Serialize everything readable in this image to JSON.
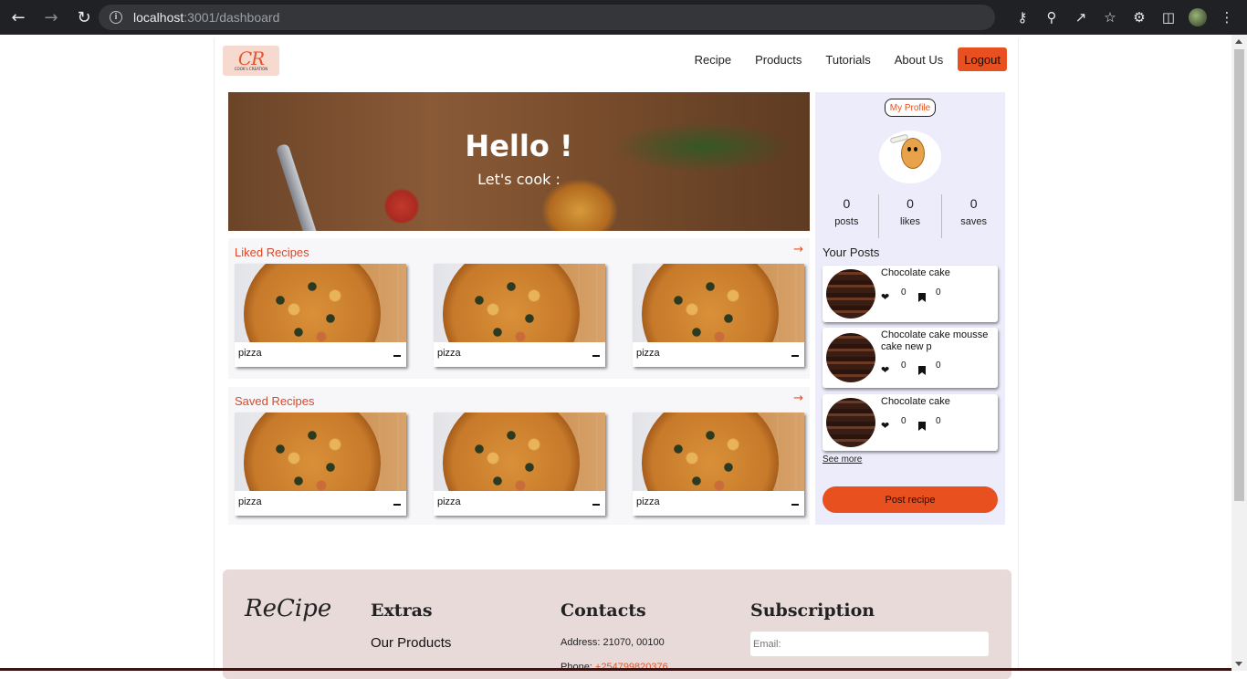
{
  "browser": {
    "url_host": "localhost",
    "url_path": ":3001/dashboard"
  },
  "logo": {
    "mark": "CR",
    "tagline": "COOK's CREATION"
  },
  "nav": {
    "items": [
      "Recipe",
      "Products",
      "Tutorials",
      "About Us"
    ],
    "logout": "Logout"
  },
  "hero": {
    "greeting": "Hello !",
    "subtitle": "Let's cook :"
  },
  "liked": {
    "title": "Liked Recipes",
    "arrow": "→",
    "cards": [
      {
        "name": "pizza"
      },
      {
        "name": "pizza"
      },
      {
        "name": "pizza"
      }
    ]
  },
  "saved": {
    "title": "Saved Recipes",
    "arrow": "→",
    "cards": [
      {
        "name": "pizza"
      },
      {
        "name": "pizza"
      },
      {
        "name": "pizza"
      }
    ]
  },
  "profile": {
    "button": "My Profile",
    "stats": [
      {
        "value": "0",
        "label": "posts"
      },
      {
        "value": "0",
        "label": "likes"
      },
      {
        "value": "0",
        "label": "saves"
      }
    ],
    "posts_title": "Your Posts",
    "posts": [
      {
        "title": "Chocolate cake",
        "likes": "0",
        "saves": "0"
      },
      {
        "title": "Chocolate cake mousse cake new p",
        "likes": "0",
        "saves": "0"
      },
      {
        "title": "Chocolate cake",
        "likes": "0",
        "saves": "0"
      }
    ],
    "see_more": "See more",
    "post_button": "Post recipe"
  },
  "footer": {
    "brand": "ReCipe",
    "extras_head": "Extras",
    "extras_item": "Our Products",
    "contacts_head": "Contacts",
    "address": "Address: 21070, 00100",
    "phone_label": "Phone: ",
    "phone": "+254799820376",
    "subscription_head": "Subscription",
    "email_placeholder": "Email:"
  },
  "colors": {
    "accent": "#e8501f",
    "sidebar": "#ececfb",
    "footer": "#e9dada"
  }
}
